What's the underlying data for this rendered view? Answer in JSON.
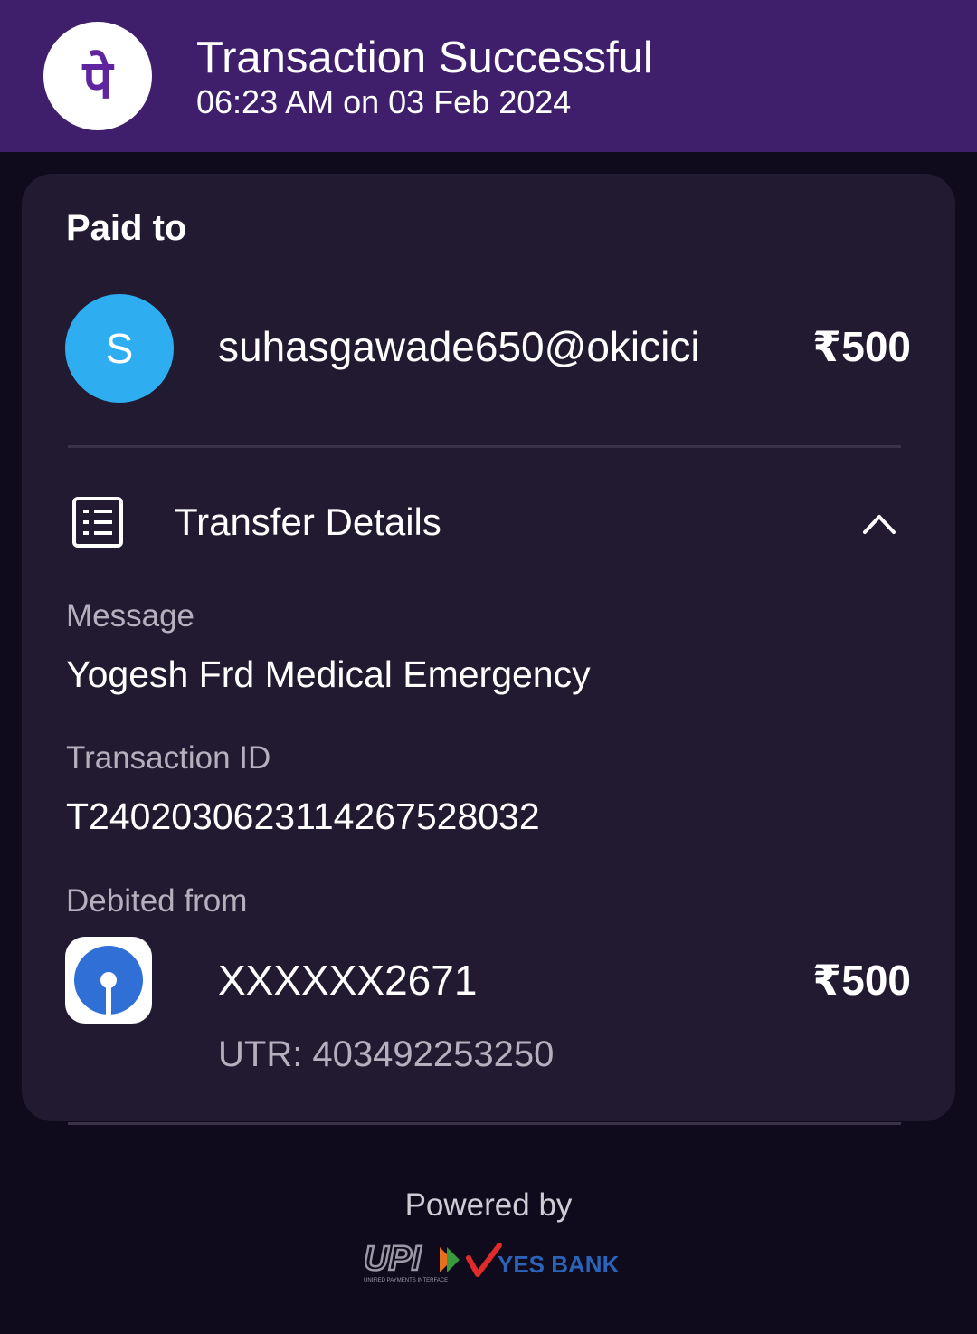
{
  "header": {
    "title": "Transaction Successful",
    "subtitle": "06:23 AM on 03 Feb 2024",
    "logo_icon": "phonepe-logo",
    "logo_glyph": "पे",
    "background_color": "#3f1f6c",
    "brand_color": "#5f259f"
  },
  "paid_to": {
    "label": "Paid to",
    "avatar_letter": "S",
    "avatar_color": "#2eaef1",
    "payee": "suhasgawade650@okicici",
    "amount": "₹500"
  },
  "transfer_details": {
    "title": "Transfer Details",
    "icon": "receipt-list-icon",
    "toggle_icon": "chevron-up-icon",
    "expanded": true,
    "message_label": "Message",
    "message_value": "Yogesh Frd Medical Emergency",
    "transaction_id_label": "Transaction ID",
    "transaction_id_value": "T2402030623114267528032",
    "debited_from_label": "Debited from",
    "bank_icon": "sbi-bank-logo",
    "bank_color": "#2f6fd6",
    "account": "XXXXXX2671",
    "amount": "₹500",
    "utr": "UTR: 403492253250"
  },
  "footer": {
    "powered_by": "Powered by",
    "upi_logo_text": "UPI",
    "upi_tagline": "UNIFIED PAYMENTS INTERFACE",
    "bank_logo_text": "YES BANK"
  }
}
